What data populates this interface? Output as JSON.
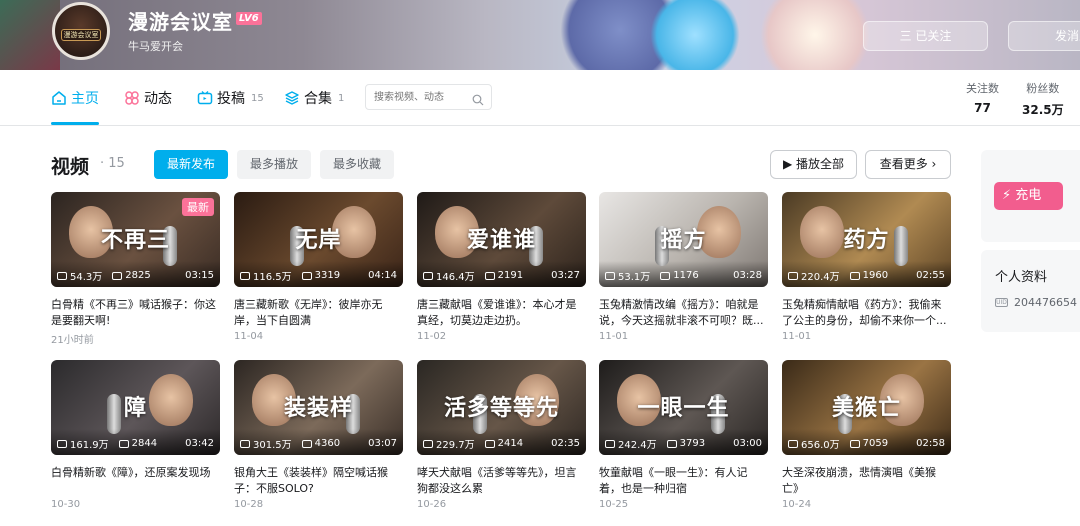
{
  "banner": {
    "avatar_label": "漫游会议室",
    "username": "漫游会议室",
    "level": "LV6",
    "signature": "牛马爱开会",
    "follow_label": "三 已关注",
    "message_label": "发消息"
  },
  "nav": {
    "tabs": [
      {
        "label": "主页",
        "count": ""
      },
      {
        "label": "动态",
        "count": ""
      },
      {
        "label": "投稿",
        "count": "15"
      },
      {
        "label": "合集",
        "count": "1"
      }
    ],
    "search_placeholder": "搜索视频、动态",
    "stats": [
      {
        "label": "关注数",
        "value": "77"
      },
      {
        "label": "粉丝数",
        "value": "32.5万"
      }
    ]
  },
  "section": {
    "title": "视频",
    "count": "· 15",
    "sort": [
      "最新发布",
      "最多播放",
      "最多收藏"
    ],
    "play_all": "▶ 播放全部",
    "more": "查看更多 ›"
  },
  "videos": [
    {
      "overlay": "不再三",
      "plays": "54.3万",
      "danmaku": "2825",
      "duration": "03:15",
      "title": "白骨精《不再三》喊话猴子：你这是要翻天啊!",
      "date": "21小时前",
      "new": "最新"
    },
    {
      "overlay": "无岸",
      "plays": "116.5万",
      "danmaku": "3319",
      "duration": "04:14",
      "title": "唐三藏新歌《无岸》：彼岸亦无岸，当下自圆满",
      "date": "11-04"
    },
    {
      "overlay": "爱谁谁",
      "plays": "146.4万",
      "danmaku": "2191",
      "duration": "03:27",
      "title": "唐三藏献唱《爱谁谁》：本心才是真经，切莫边走边扔。",
      "date": "11-02"
    },
    {
      "overlay": "摇方",
      "plays": "53.1万",
      "danmaku": "1176",
      "duration": "03:28",
      "title": "玉兔精激情改编《摇方》：咱就是说，今天这摇就非滚不可呗？既...",
      "date": "11-01"
    },
    {
      "overlay": "药方",
      "plays": "220.4万",
      "danmaku": "1960",
      "duration": "02:55",
      "title": "玉兔精痴情献唱《药方》：我偷来了公主的身份，却偷不来你一个...",
      "date": "11-01"
    },
    {
      "overlay": "障",
      "plays": "161.9万",
      "danmaku": "2844",
      "duration": "03:42",
      "title": "白骨精新歌《障》，还原案发现场",
      "date": "10-30"
    },
    {
      "overlay": "装装样",
      "plays": "301.5万",
      "danmaku": "4360",
      "duration": "03:07",
      "title": "银角大王《装装样》隔空喊话猴子：不服SOLO?",
      "date": "10-28"
    },
    {
      "overlay": "活多等等先",
      "plays": "229.7万",
      "danmaku": "2414",
      "duration": "02:35",
      "title": "哮天犬献唱《活爹等等先》，坦言狗都没这么累",
      "date": "10-26"
    },
    {
      "overlay": "一眼一生",
      "plays": "242.4万",
      "danmaku": "3793",
      "duration": "03:00",
      "title": "牧童献唱《一眼一生》：有人记着，也是一种归宿",
      "date": "10-25"
    },
    {
      "overlay": "美猴亡",
      "plays": "656.0万",
      "danmaku": "7059",
      "duration": "02:58",
      "title": "大圣深夜崩溃，悲情演唱《美猴亡》",
      "date": "10-24"
    }
  ],
  "sidebar": {
    "charge_label": "充电",
    "profile_title": "个人资料",
    "uid": "204476654"
  },
  "colors": {
    "accent": "#00aeec",
    "pink": "#fb7299"
  }
}
